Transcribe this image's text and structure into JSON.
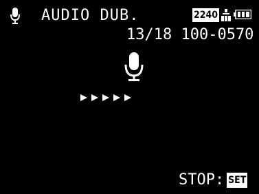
{
  "top_bar": {
    "mode_icon": "microphone-icon",
    "mode_label": "AUDIO DUB.",
    "resolution": "2240",
    "quality_icon": "quality-icon",
    "battery_icon": "battery-icon"
  },
  "counter": "13/18 100-0570",
  "center_icon": "microphone-icon",
  "progress": {
    "icon": "play-arrows-icon",
    "arrow_count": 5
  },
  "footer": {
    "stop_label": "STOP:",
    "set_key_label": "SET"
  },
  "colors": {
    "background": "#000000",
    "foreground": "#ffffff",
    "badge_text": "#000000"
  }
}
